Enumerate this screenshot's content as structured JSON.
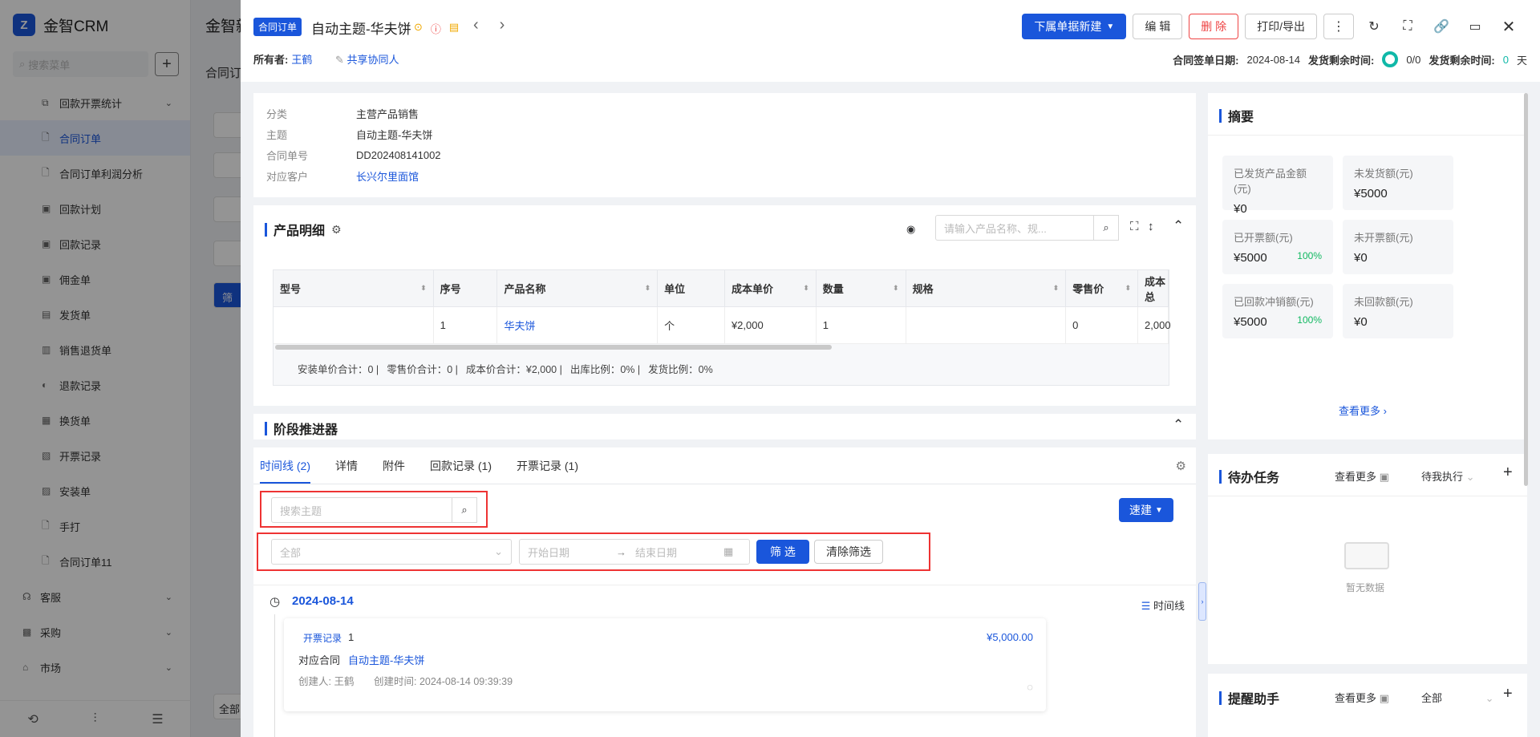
{
  "app": {
    "name": "金智CRM",
    "search_placeholder": "搜索菜单"
  },
  "sidebar": {
    "items": [
      {
        "label": "回款开票统计",
        "icon": "copy-icon",
        "chev": "⌄"
      },
      {
        "label": "合同订单",
        "icon": "doc-icon",
        "active": true
      },
      {
        "label": "合同订单利润分析",
        "icon": "doc-icon"
      },
      {
        "label": "回款计划",
        "icon": "plan-icon"
      },
      {
        "label": "回款记录",
        "icon": "plan-icon"
      },
      {
        "label": "佣金单",
        "icon": "plan-icon"
      },
      {
        "label": "发货单",
        "icon": "ship-icon"
      },
      {
        "label": "销售退货单",
        "icon": "return-icon"
      },
      {
        "label": "退款记录",
        "icon": "refund-icon"
      },
      {
        "label": "换货单",
        "icon": "exchange-icon"
      },
      {
        "label": "开票记录",
        "icon": "invoice-icon"
      },
      {
        "label": "安装单",
        "icon": "install-icon"
      },
      {
        "label": "手打",
        "icon": "doc-icon"
      },
      {
        "label": "合同订单11",
        "icon": "doc-icon"
      }
    ],
    "groups": [
      {
        "label": "客服",
        "icon": "service-icon"
      },
      {
        "label": "采购",
        "icon": "purchase-icon"
      },
      {
        "label": "市场",
        "icon": "market-icon"
      }
    ]
  },
  "bg": {
    "tab_title": "金智新",
    "sub_title": "合同订",
    "btn_label": "筛",
    "bottom_label": "全部"
  },
  "header": {
    "tag": "合同订单",
    "title": "自动主题-华夫饼",
    "owner_label": "所有者:",
    "owner_name": "王鹤",
    "share_label": "共享协同人",
    "btn_sub_create": "下属单据新建",
    "btn_edit": "编 辑",
    "btn_delete": "删 除",
    "btn_print": "打印/导出",
    "sign_label": "合同签单日期:",
    "sign_date": "2024-08-14",
    "ship_left_label1": "发货剩余时间:",
    "ship_progress": "0/0",
    "ship_left_label2": "发货剩余时间:",
    "ship_left_value": "0",
    "ship_left_unit": "天"
  },
  "info": {
    "rows": [
      {
        "k": "分类",
        "v": "主营产品销售",
        "link": false
      },
      {
        "k": "主题",
        "v": "自动主题-华夫饼",
        "link": false
      },
      {
        "k": "合同单号",
        "v": "DD202408141002",
        "link": false
      },
      {
        "k": "对应客户",
        "v": "长兴尔里面馆",
        "link": true
      }
    ]
  },
  "products": {
    "title": "产品明细",
    "search_placeholder": "请输入产品名称、规...",
    "columns": [
      "型号",
      "序号",
      "产品名称",
      "单位",
      "成本单价",
      "数量",
      "规格",
      "零售价",
      "成本总"
    ],
    "rows": [
      {
        "model": "",
        "seq": "1",
        "name": "华夫饼",
        "unit": "个",
        "cost": "¥2,000",
        "qty": "1",
        "spec": "",
        "retail": "0",
        "cost_total": "2,000"
      }
    ],
    "summary": [
      "安装单价合计：0 |",
      "零售价合计：0 |",
      "成本价合计：¥2,000 |",
      "出库比例：0% |",
      "发货比例：0%"
    ]
  },
  "stage": {
    "title": "阶段推进器"
  },
  "timeline": {
    "tabs": [
      "时间线 (2)",
      "详情",
      "附件",
      "回款记录 (1)",
      "开票记录 (1)"
    ],
    "search_placeholder": "搜索主题",
    "quick_create": "速建",
    "filter_select": "全部",
    "start_placeholder": "开始日期",
    "end_placeholder": "结束日期",
    "btn_filter": "筛 选",
    "btn_clear": "清除筛选",
    "date": "2024-08-14",
    "view_label": "时间线",
    "entry": {
      "type": "开票记录",
      "count": "1",
      "amount": "¥5,000.00",
      "contract_label": "对应合同",
      "contract_link": "自动主题-华夫饼",
      "creator": "创建人: 王鹤",
      "created": "创建时间: 2024-08-14 09:39:39"
    }
  },
  "abstract": {
    "title": "摘要",
    "stats": [
      {
        "label": "已发货产品金额(元)",
        "value": "¥0",
        "pct": ""
      },
      {
        "label": "未发货额(元)",
        "value": "¥5000",
        "pct": ""
      },
      {
        "label": "已开票额(元)",
        "value": "¥5000",
        "pct": "100%"
      },
      {
        "label": "未开票额(元)",
        "value": "¥0",
        "pct": ""
      },
      {
        "label": "已回款冲销额(元)",
        "value": "¥5000",
        "pct": "100%"
      },
      {
        "label": "未回款额(元)",
        "value": "¥0",
        "pct": ""
      }
    ],
    "more": "查看更多"
  },
  "todo": {
    "title": "待办任务",
    "more": "查看更多",
    "filter": "待我执行",
    "empty": "暂无数据"
  },
  "reminder": {
    "title": "提醒助手",
    "more": "查看更多",
    "filter": "全部"
  },
  "colors": {
    "accent": "#1a56db",
    "danger": "#e44444",
    "success": "#10b860",
    "teal": "#10b8a8"
  }
}
